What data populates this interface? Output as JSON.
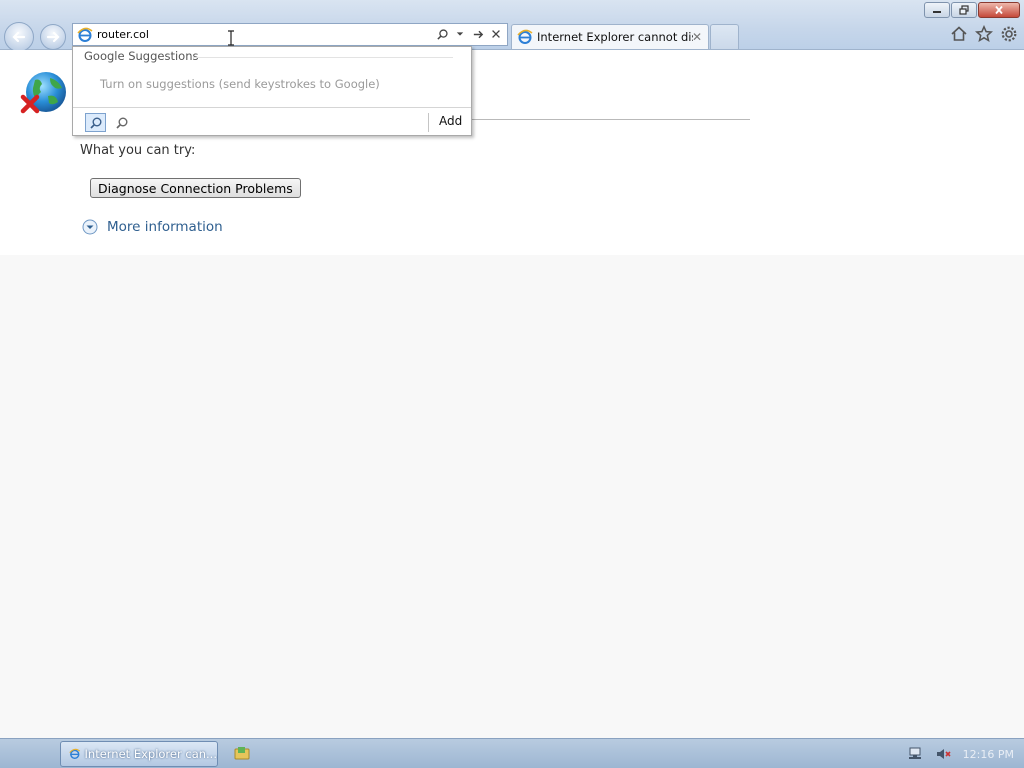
{
  "address_bar": {
    "value": "router.col",
    "tools": [
      "search-icon",
      "dropdown-icon",
      "go-arrow-icon",
      "stop-icon"
    ]
  },
  "tab": {
    "title": "Internet Explorer cannot dis...",
    "close_glyph": "✕"
  },
  "window_controls": [
    "minimize-icon",
    "restore-icon",
    "close-icon"
  ],
  "toolbar_right": [
    "home-icon",
    "favorites-icon",
    "tools-gear-icon"
  ],
  "suggestions": {
    "header": "Google Suggestions",
    "turn_on_text": "Turn on suggestions (send keystrokes to Google)",
    "add_label": "Add"
  },
  "page": {
    "try_label": "What you can try:",
    "diagnose_button": "Diagnose Connection Problems",
    "more_info": "More information"
  },
  "taskbar": {
    "ie_task_label": "Internet Explorer can...",
    "clock": "12:16 PM"
  },
  "colors": {
    "link": "#2f5f8f",
    "chrome": "#c6d6ea",
    "taskbar": "#9db6d2"
  }
}
